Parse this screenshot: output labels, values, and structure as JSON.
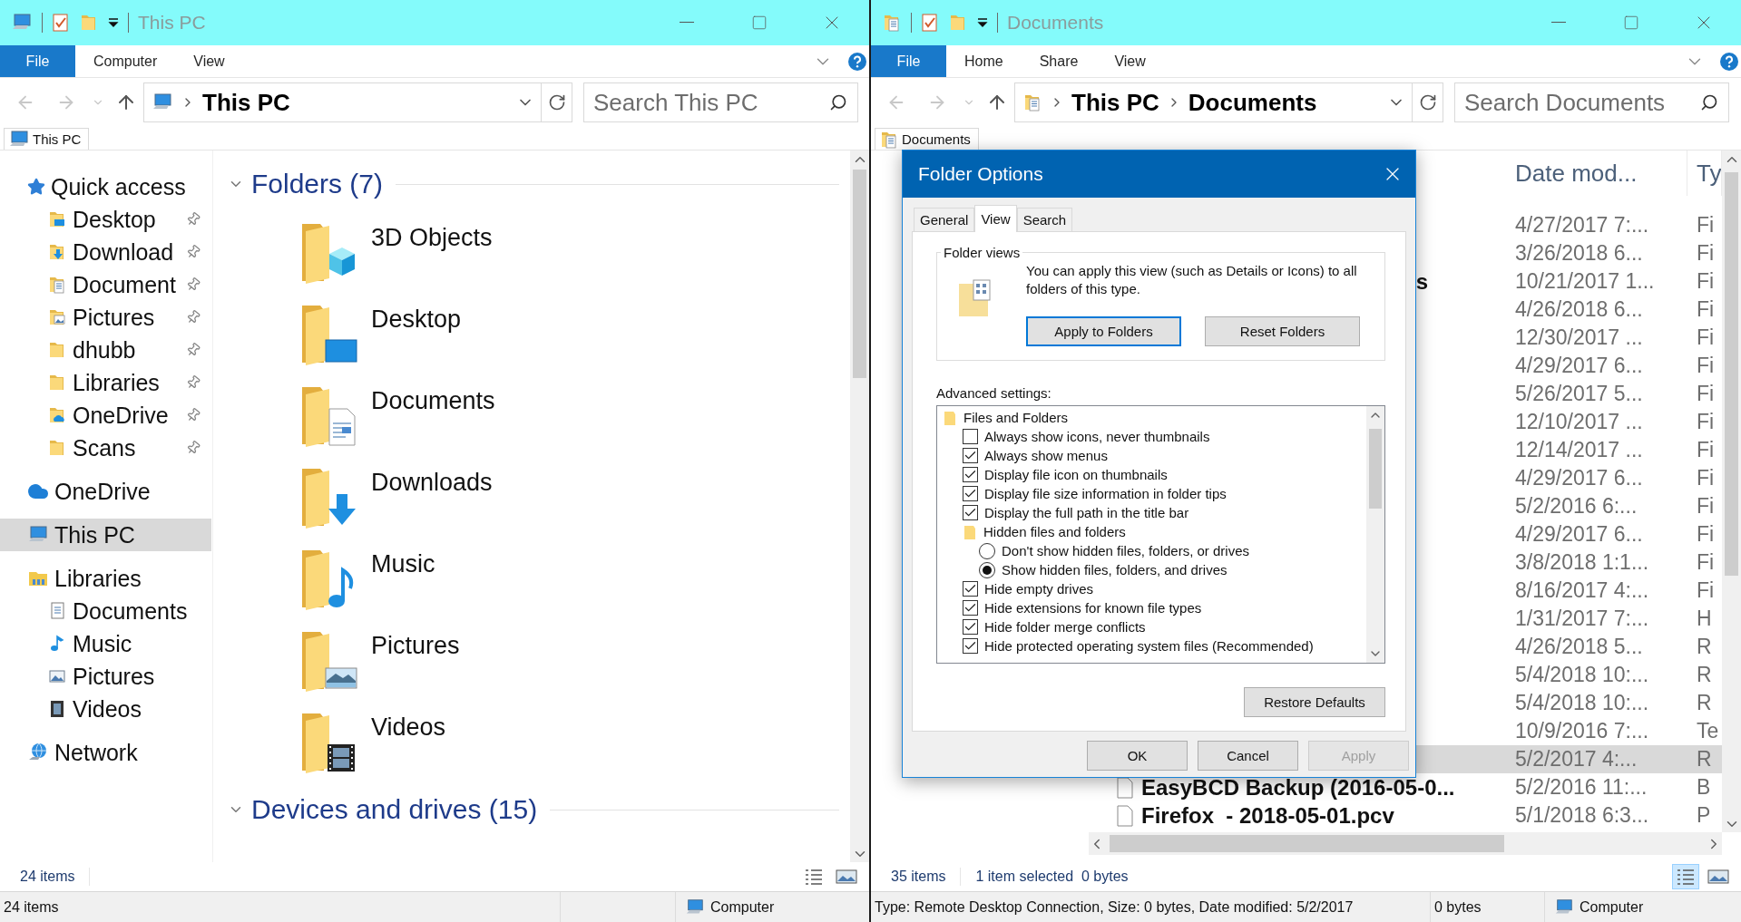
{
  "windows": [
    {
      "title": "This PC",
      "kind": "pc",
      "ribbon": {
        "file": "File",
        "tabs": [
          "Computer",
          "View"
        ]
      },
      "address": {
        "crumbs": [
          "This PC"
        ]
      },
      "search": {
        "placeholder": "Search This PC"
      },
      "location_tab": "This PC",
      "nav": [
        {
          "label": "Quick access",
          "kind": "star",
          "selected": false,
          "children": [
            {
              "label": "Desktop",
              "kind": "desktop",
              "pinned": true,
              "selected": false
            },
            {
              "label": "Download",
              "kind": "downloads",
              "pinned": true,
              "selected": false
            },
            {
              "label": "Document",
              "kind": "documents",
              "pinned": true,
              "selected": false
            },
            {
              "label": "Pictures",
              "kind": "pictures",
              "pinned": true,
              "selected": false
            },
            {
              "label": "dhubb",
              "kind": "folder",
              "pinned": true,
              "selected": false
            },
            {
              "label": "Libraries",
              "kind": "folder",
              "pinned": true,
              "selected": false
            },
            {
              "label": "OneDrive",
              "kind": "onedrive_folder",
              "pinned": true,
              "selected": false
            },
            {
              "label": "Scans",
              "kind": "folder",
              "pinned": true,
              "selected": false
            }
          ]
        },
        {
          "label": "OneDrive",
          "kind": "cloud",
          "selected": false
        },
        {
          "label": "This PC",
          "kind": "pc",
          "selected": true
        },
        {
          "label": "Libraries",
          "kind": "library",
          "selected": false,
          "children": [
            {
              "label": "Documents",
              "kind": "doc_page",
              "selected": false
            },
            {
              "label": "Music",
              "kind": "note",
              "selected": false
            },
            {
              "label": "Pictures",
              "kind": "picture",
              "selected": false
            },
            {
              "label": "Videos",
              "kind": "film",
              "selected": false
            }
          ]
        },
        {
          "label": "Network",
          "kind": "network",
          "selected": false
        }
      ],
      "sections": [
        {
          "heading": "Folders (7)",
          "expanded": true,
          "items": [
            {
              "label": "3D Objects",
              "kind": "cube"
            },
            {
              "label": "Desktop",
              "kind": "desktop"
            },
            {
              "label": "Documents",
              "kind": "documents"
            },
            {
              "label": "Downloads",
              "kind": "downloads"
            },
            {
              "label": "Music",
              "kind": "music"
            },
            {
              "label": "Pictures",
              "kind": "pictures"
            },
            {
              "label": "Videos",
              "kind": "videos"
            }
          ]
        },
        {
          "heading": "Devices and drives (15)",
          "expanded": true
        }
      ],
      "status": {
        "texts": [
          "24 items"
        ],
        "views": [
          {
            "kind": "details",
            "selected": false
          },
          {
            "kind": "thumbnails",
            "selected": false
          }
        ]
      },
      "bottom_bar": {
        "texts": [
          "24 items"
        ],
        "location": "Computer"
      }
    },
    {
      "title": "Documents",
      "kind": "documents",
      "ribbon": {
        "file": "File",
        "tabs": [
          "Home",
          "Share",
          "View"
        ]
      },
      "address": {
        "crumbs": [
          "This PC",
          "Documents"
        ]
      },
      "search": {
        "placeholder": "Search Documents"
      },
      "location_tab": "Documents",
      "list": {
        "columns": [
          "Date mod...",
          "Ty"
        ],
        "rows": [
          {
            "date": "4/27/2017 7:...",
            "type": "Fi",
            "selected": false
          },
          {
            "date": "3/26/2018 6...",
            "type": "Fi",
            "selected": false
          },
          {
            "name_tail": "s",
            "date": "10/21/2017 1...",
            "type": "Fi",
            "selected": false
          },
          {
            "date": "4/26/2018 6...",
            "type": "Fi",
            "selected": false
          },
          {
            "date": "12/30/2017 ...",
            "type": "Fi",
            "selected": false
          },
          {
            "date": "4/29/2017 6...",
            "type": "Fi",
            "selected": false
          },
          {
            "date": "5/26/2017 5...",
            "type": "Fi",
            "selected": false
          },
          {
            "date": "12/10/2017 ...",
            "type": "Fi",
            "selected": false
          },
          {
            "date": "12/14/2017 ...",
            "type": "Fi",
            "selected": false
          },
          {
            "date": "4/29/2017 6...",
            "type": "Fi",
            "selected": false
          },
          {
            "date": "5/2/2016 6:...",
            "type": "Fi",
            "selected": false
          },
          {
            "date": "4/29/2017 6...",
            "type": "Fi",
            "selected": false
          },
          {
            "date": "3/8/2018 1:1...",
            "type": "Fi",
            "selected": false
          },
          {
            "date": "8/16/2017 4:...",
            "type": "Fi",
            "selected": false
          },
          {
            "date": "1/31/2017 7:...",
            "type": "H",
            "selected": false
          },
          {
            "date": "4/26/2018 5...",
            "type": "R",
            "selected": false
          },
          {
            "date": "5/4/2018 10:...",
            "type": "R",
            "selected": false
          },
          {
            "date": "5/4/2018 10:...",
            "type": "R",
            "selected": false
          },
          {
            "date": "10/9/2016 7:...",
            "type": "Te",
            "selected": false
          },
          {
            "date": "5/2/2017 4:...",
            "type": "R",
            "selected": true
          },
          {
            "name": "EasyBCD Backup (2016-05-0...",
            "date": "5/2/2016 11:...",
            "type": "B",
            "selected": false
          },
          {
            "name": "Firefox  - 2018-05-01.pcv",
            "date": "5/1/2018 6:3...",
            "type": "P",
            "selected": false
          }
        ]
      },
      "status": {
        "texts": [
          "35 items",
          "1 item selected  0 bytes"
        ],
        "views": [
          {
            "kind": "details",
            "selected": true
          },
          {
            "kind": "thumbnails",
            "selected": false
          }
        ]
      },
      "bottom_bar": {
        "texts": [
          "Type: Remote Desktop Connection, Size: 0 bytes, Date modified: 5/2/2017",
          "0 bytes"
        ],
        "location": "Computer"
      },
      "dialog": {
        "title": "Folder Options",
        "tabs": [
          {
            "label": "General",
            "selected": false
          },
          {
            "label": "View",
            "selected": true
          },
          {
            "label": "Search",
            "selected": false
          }
        ],
        "group": "Folder views",
        "description": "You can apply this view (such as Details or Icons) to all folders of this type.",
        "buttons": [
          {
            "label": "Apply to Folders",
            "default": true
          },
          {
            "label": "Reset Folders",
            "default": false
          }
        ],
        "advanced_label": "Advanced settings:",
        "settings": [
          {
            "kind": "folder",
            "label": "Files and Folders",
            "children": [
              {
                "kind": "checkbox",
                "label": "Always show icons, never thumbnails",
                "checked": false
              },
              {
                "kind": "checkbox",
                "label": "Always show menus",
                "checked": true
              },
              {
                "kind": "checkbox",
                "label": "Display file icon on thumbnails",
                "checked": true
              },
              {
                "kind": "checkbox",
                "label": "Display file size information in folder tips",
                "checked": true
              },
              {
                "kind": "checkbox",
                "label": "Display the full path in the title bar",
                "checked": true
              },
              {
                "kind": "folder",
                "label": "Hidden files and folders",
                "children": [
                  {
                    "kind": "radio",
                    "label": "Don't show hidden files, folders, or drives",
                    "selected": false
                  },
                  {
                    "kind": "radio",
                    "label": "Show hidden files, folders, and drives",
                    "selected": true
                  }
                ]
              },
              {
                "kind": "checkbox",
                "label": "Hide empty drives",
                "checked": true
              },
              {
                "kind": "checkbox",
                "label": "Hide extensions for known file types",
                "checked": true
              },
              {
                "kind": "checkbox",
                "label": "Hide folder merge conflicts",
                "checked": true
              },
              {
                "kind": "checkbox",
                "label": "Hide protected operating system files (Recommended)",
                "checked": true
              }
            ]
          }
        ],
        "restore": "Restore Defaults",
        "footer": [
          {
            "label": "OK",
            "disabled": false
          },
          {
            "label": "Cancel",
            "disabled": false
          },
          {
            "label": "Apply",
            "disabled": true
          }
        ]
      }
    }
  ]
}
